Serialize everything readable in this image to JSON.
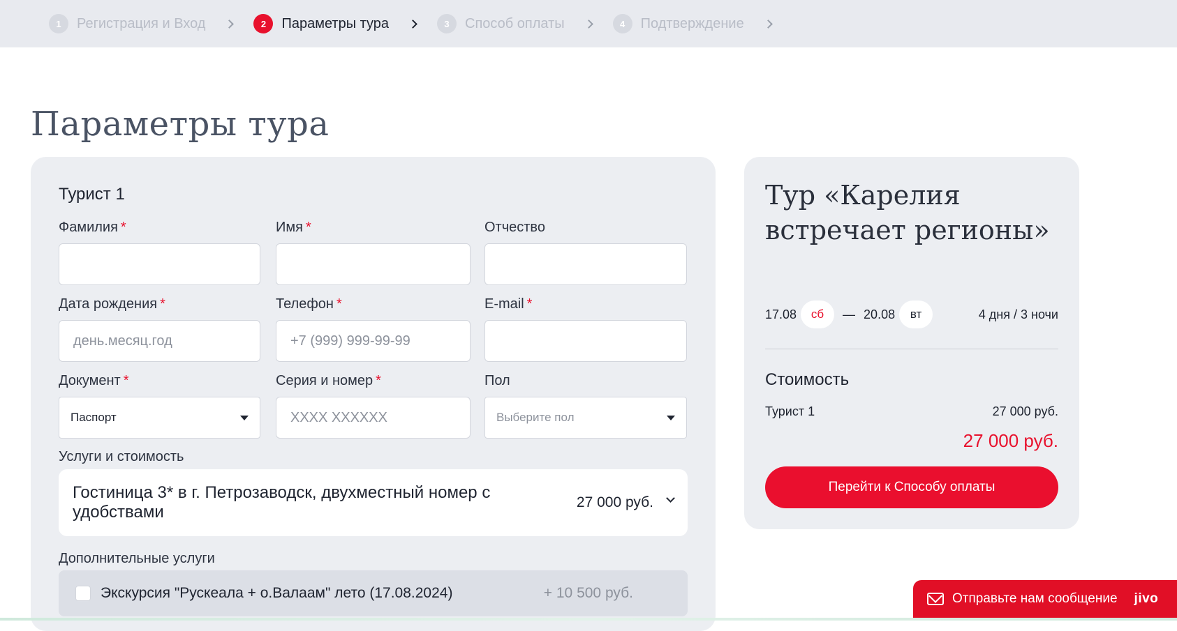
{
  "stepper": {
    "steps": [
      {
        "num": "1",
        "label": "Регистрация и Вход"
      },
      {
        "num": "2",
        "label": "Параметры тура"
      },
      {
        "num": "3",
        "label": "Способ оплаты"
      },
      {
        "num": "4",
        "label": "Подтверждение"
      }
    ],
    "active_index": 1
  },
  "page_title": "Параметры тура",
  "form": {
    "tourist_title": "Турист 1",
    "fields": {
      "last_name": {
        "label": "Фамилия",
        "required": "*",
        "value": "",
        "placeholder": ""
      },
      "first_name": {
        "label": "Имя",
        "required": "*",
        "value": "",
        "placeholder": ""
      },
      "patronymic": {
        "label": "Отчество",
        "value": "",
        "placeholder": ""
      },
      "birth_date": {
        "label": "Дата рождения",
        "required": "*",
        "value": "",
        "placeholder": "день.месяц.год"
      },
      "phone": {
        "label": "Телефон",
        "required": "*",
        "value": "",
        "placeholder": "+7 (999) 999-99-99"
      },
      "email": {
        "label": "E-mail",
        "required": "*",
        "value": "",
        "placeholder": ""
      },
      "document": {
        "label": "Документ",
        "required": "*",
        "selected": "Паспорт"
      },
      "doc_number": {
        "label": "Серия и номер",
        "required": "*",
        "value": "",
        "placeholder": "XXXX XXXXXX"
      },
      "gender": {
        "label": "Пол",
        "placeholder": "Выберите пол"
      }
    },
    "services_label": "Услуги и стоимость",
    "service": {
      "name": "Гостиница 3* в г. Петрозаводск, двухместный номер с удобствами",
      "price": "27 000 руб."
    },
    "extra_label": "Дополнительные услуги",
    "extra": {
      "name": "Экскурсия \"Рускеала + о.Валаам\" лето (17.08.2024)",
      "price": "+ 10 500 руб.",
      "checked": false
    }
  },
  "summary": {
    "tour_title": "Тур «Карелия встречает регионы»",
    "start_date": "17.08",
    "start_day": "сб",
    "dash": "—",
    "end_date": "20.08",
    "end_day": "вт",
    "duration": "4 дня / 3 ночи",
    "cost_title": "Стоимость",
    "cost_rows": [
      {
        "label": "Турист 1",
        "amount": "27 000 руб."
      }
    ],
    "total": "27 000 руб.",
    "pay_button": "Перейти к Способу оплаты"
  },
  "chat": {
    "text": "Отправьте нам сообщение",
    "brand": "jivo",
    "icon": "mail-icon"
  },
  "colors": {
    "accent": "#e8112d",
    "card_bg": "#eceef2",
    "stepper_bg": "#e8eaef"
  }
}
